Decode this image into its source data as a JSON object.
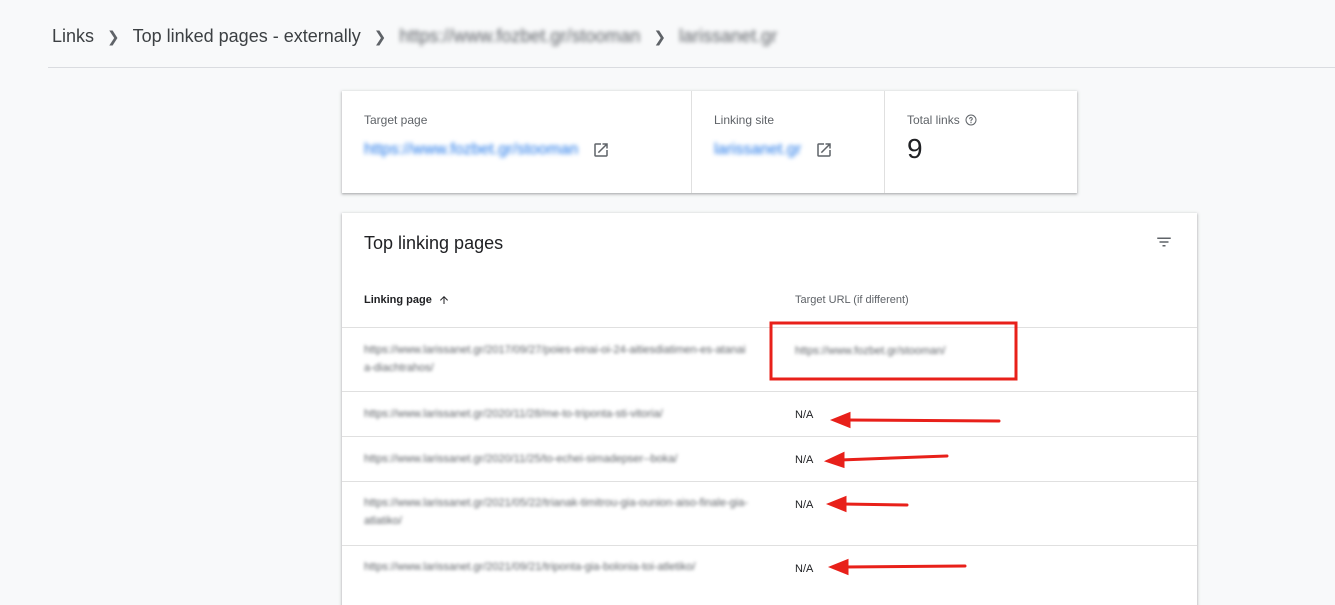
{
  "breadcrumb": {
    "items": [
      "Links",
      "Top linked pages - externally",
      "https://www.fozbet.gr/stooman",
      "larissanet.gr"
    ]
  },
  "summary": {
    "target_page_label": "Target page",
    "target_page_value": "https://www.fozbet.gr/stooman",
    "linking_site_label": "Linking site",
    "linking_site_value": "larissanet.gr",
    "total_links_label": "Total links",
    "total_links_value": "9"
  },
  "table": {
    "title": "Top linking pages",
    "col_linking": "Linking page",
    "col_target": "Target URL (if different)",
    "rows": [
      {
        "linking_page": "https://www.larissanet.gr/2017/09/27/poies-einai-oi-24-aitiesdiatimen-es-atanaia-diachtrahos/",
        "target": "https://www.fozbet.gr/stooman/"
      },
      {
        "linking_page": "https://www.larissanet.gr/2020/11/28/me-to-triponta-sti-vitoria/",
        "target": "N/A"
      },
      {
        "linking_page": "https://www.larissanet.gr/2020/11/25/to-echei-simadepser--boka/",
        "target": "N/A"
      },
      {
        "linking_page": "https://www.larissanet.gr/2021/05/22/trianak-timitrou-gia-ounion-aiso-finale-gia-atlatiko/",
        "target": "N/A"
      },
      {
        "linking_page": "https://www.larissanet.gr/2021/09/21/triponta-gia-bolonia-toi-atletiko/",
        "target": "N/A"
      }
    ]
  },
  "colors": {
    "link": "#1a73e8",
    "annotation": "#e8201a"
  },
  "icons": {
    "breadcrumb_separator": "chevron-right-icon",
    "external": "open-in-new-icon",
    "help": "help-circle-icon",
    "filter": "filter-list-icon",
    "sort": "arrow-up-icon"
  }
}
